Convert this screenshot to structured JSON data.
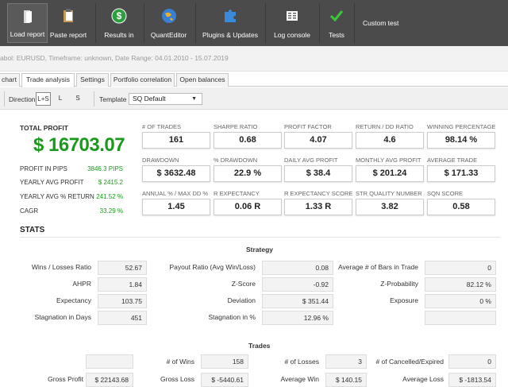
{
  "toolbar": {
    "buttons": [
      {
        "label": "Load report",
        "icon": "document-icon"
      },
      {
        "label": "Paste report",
        "icon": "clipboard-icon"
      },
      {
        "label": "Results in",
        "icon": "dollar-icon"
      },
      {
        "label": "QuantEditor",
        "icon": "globe-icon"
      },
      {
        "label": "Plugins & Updates",
        "icon": "puzzle-icon"
      },
      {
        "label": "Log console",
        "icon": "console-icon"
      },
      {
        "label": "Tests",
        "icon": "checkmark-icon"
      }
    ],
    "custom_test": "Custom test"
  },
  "infobar": {
    "text": "abol: EURUSD, Timeframe: unknown, Date Range: 04.01.2010 - 15.07.2019"
  },
  "tabs": [
    "chart",
    "Trade analysis",
    "Settings",
    "Portfolio correlation",
    "Open balances"
  ],
  "options": {
    "direction_label": "Direction",
    "directions": [
      "L+S",
      "L",
      "S"
    ],
    "template_label": "Template",
    "template_value": "SQ Default"
  },
  "summary": {
    "total_profit_label": "TOTAL PROFIT",
    "total_profit_value": "$ 16703.07",
    "items": [
      {
        "label": "PROFIT IN PIPS",
        "value": "3846.3 PIPS"
      },
      {
        "label": "YEARLY AVG PROFIT",
        "value": "$ 2415.2"
      },
      {
        "label": "YEARLY AVG % RETURN",
        "value": "241.52 %"
      },
      {
        "label": "CAGR",
        "value": "33.29 %"
      }
    ]
  },
  "metrics": [
    [
      {
        "label": "# OF TRADES",
        "value": "161"
      },
      {
        "label": "SHARPE RATIO",
        "value": "0.68"
      },
      {
        "label": "PROFIT FACTOR",
        "value": "4.07"
      },
      {
        "label": "RETURN / DD RATIO",
        "value": "4.6"
      },
      {
        "label": "WINNING PERCENTAGE",
        "value": "98.14 %"
      }
    ],
    [
      {
        "label": "DRAWDOWN",
        "value": "$ 3632.48"
      },
      {
        "label": "% DRAWDOWN",
        "value": "22.9 %"
      },
      {
        "label": "DAILY AVG PROFIT",
        "value": "$ 38.4"
      },
      {
        "label": "MONTHLY AVG PROFIT",
        "value": "$ 201.24"
      },
      {
        "label": "AVERAGE TRADE",
        "value": "$ 171.33"
      }
    ],
    [
      {
        "label": "ANNUAL % / MAX DD %",
        "value": "1.45"
      },
      {
        "label": "R EXPECTANCY",
        "value": "0.06 R"
      },
      {
        "label": "R EXPECTANCY SCORE",
        "value": "1.33 R"
      },
      {
        "label": "STR QUALITY NUMBER",
        "value": "3.82"
      },
      {
        "label": "SQN SCORE",
        "value": "0.58"
      }
    ]
  ],
  "stats": {
    "title": "STATS",
    "strategy": {
      "title": "Strategy",
      "rows": [
        [
          {
            "label": "Wins / Losses Ratio",
            "value": "52.67"
          },
          {
            "label": "Payout Ratio (Avg Win/Loss)",
            "value": "0.08"
          },
          {
            "label": "Average # of Bars in Trade",
            "value": "0"
          }
        ],
        [
          {
            "label": "AHPR",
            "value": "1.84"
          },
          {
            "label": "Z-Score",
            "value": "-0.92"
          },
          {
            "label": "Z-Probability",
            "value": "82.12 %"
          }
        ],
        [
          {
            "label": "Expectancy",
            "value": "103.75"
          },
          {
            "label": "Deviation",
            "value": "$ 351.44"
          },
          {
            "label": "Exposure",
            "value": "0 %"
          }
        ],
        [
          {
            "label": "Stagnation in Days",
            "value": "451"
          },
          {
            "label": "Stagnation in %",
            "value": "12.96 %"
          },
          {
            "label": "",
            "value": ""
          }
        ]
      ]
    },
    "trades": {
      "title": "Trades",
      "rows": [
        [
          {
            "label": "",
            "value": ""
          },
          {
            "label": "# of Wins",
            "value": "158"
          },
          {
            "label": "# of Losses",
            "value": "3"
          },
          {
            "label": "# of Cancelled/Expired",
            "value": "0"
          }
        ],
        [
          {
            "label": "Gross Profit",
            "value": "$ 22143.68"
          },
          {
            "label": "Gross Loss",
            "value": "$ -5440.61"
          },
          {
            "label": "Average Win",
            "value": "$ 140.15"
          },
          {
            "label": "Average Loss",
            "value": "$ -1813.54"
          }
        ]
      ]
    }
  },
  "colors": {
    "profit_green": "#1a9a1a",
    "toolbar_bg": "#4b4b4b"
  }
}
